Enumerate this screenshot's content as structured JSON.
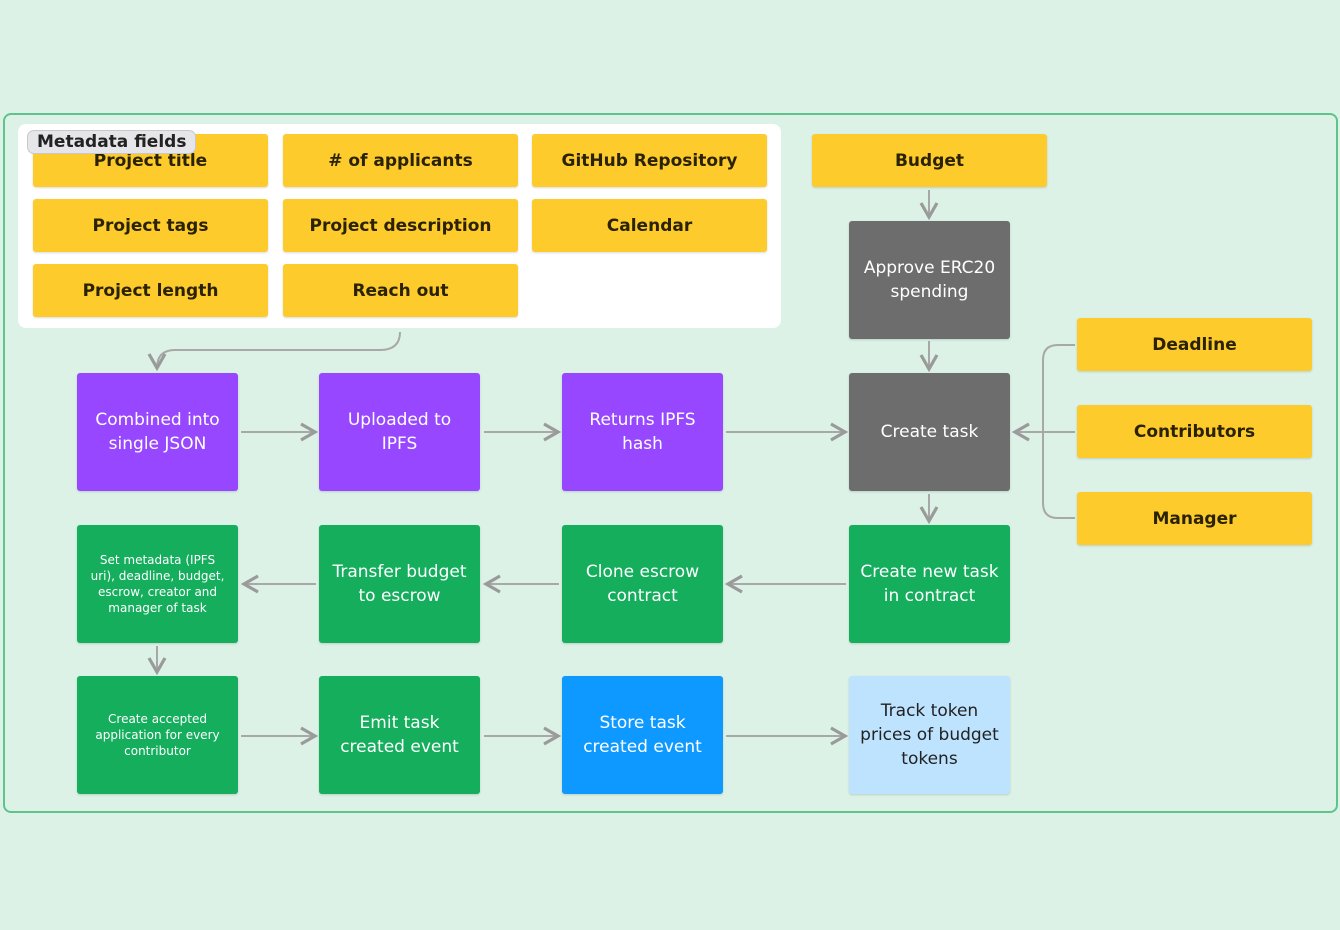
{
  "colors": {
    "background": "#dcf2e6",
    "metadata": "#fdcb2c",
    "process": "#6d6d6d",
    "ipfs": "#9747ff",
    "contract": "#14ae5c",
    "event": "#0d99ff",
    "tracking": "#bde3ff"
  },
  "metadata": {
    "label": "Metadata fields",
    "fields": [
      "Project title",
      "# of applicants",
      "GitHub Repository",
      "Project tags",
      "Project description",
      "Calendar",
      "Project length",
      "Reach out"
    ]
  },
  "budget": "Budget",
  "approve": "Approve ERC20 spending",
  "create_task": "Create task",
  "task_inputs": [
    "Deadline",
    "Contributors",
    "Manager"
  ],
  "ipfs_flow": [
    "Combined into single JSON",
    "Uploaded to IPFS",
    "Returns IPFS hash"
  ],
  "contract_flow": [
    "Set metadata (IPFS uri), deadline, budget, escrow, creator and manager of task",
    "Transfer budget to escrow",
    "Clone escrow contract",
    "Create new task in contract"
  ],
  "final_flow": [
    "Create accepted application for every contributor",
    "Emit task created event",
    "Store task created event",
    "Track token prices of budget tokens"
  ]
}
